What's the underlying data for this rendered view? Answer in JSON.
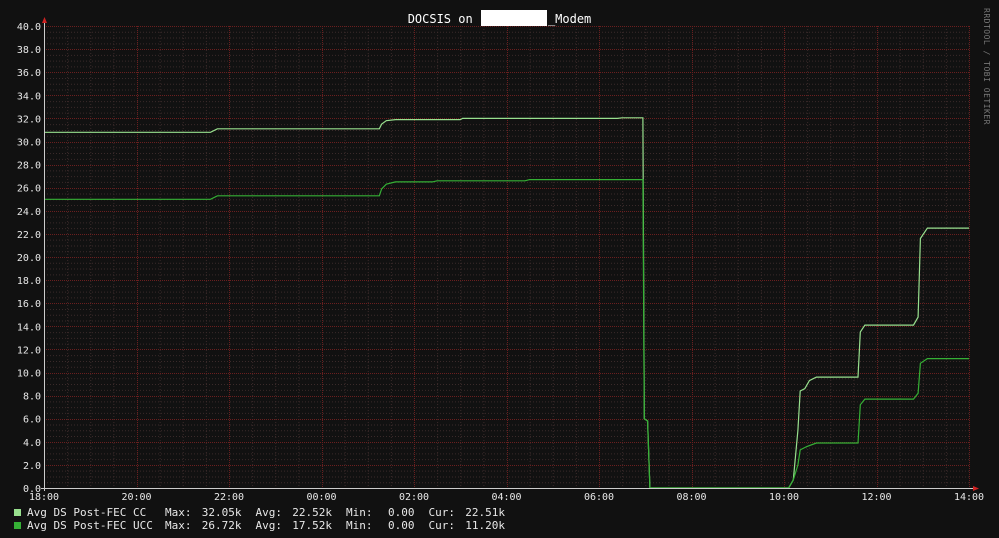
{
  "chart_data": {
    "type": "line",
    "title": "DOCSIS on [redacted]_Modem",
    "title_prefix": "DOCSIS on ",
    "title_suffix": "_Modem",
    "vertical_label": "RRDTOOL / TOBI OETIKER",
    "xlabel": "",
    "ylabel": "",
    "ylim": [
      0,
      40
    ],
    "yticks": [
      "0.0",
      "2.0",
      "4.0",
      "6.0",
      "8.0",
      "10.0",
      "12.0",
      "14.0",
      "16.0",
      "18.0",
      "20.0",
      "22.0",
      "24.0",
      "26.0",
      "28.0",
      "30.0",
      "32.0",
      "34.0",
      "36.0",
      "38.0",
      "40.0"
    ],
    "xlim": [
      0,
      20
    ],
    "xticks": [
      "18:00",
      "20:00",
      "22:00",
      "00:00",
      "02:00",
      "04:00",
      "06:00",
      "08:00",
      "10:00",
      "12:00",
      "14:00"
    ],
    "grid": true,
    "colors": {
      "background": "#111111",
      "grid_major": "#6a1f1f",
      "grid_minor": "#3a2a2a",
      "axis": "#cccccc",
      "cc": "#98e08e",
      "ucc": "#35b035"
    },
    "series": [
      {
        "name": "Avg DS Post-FEC CC",
        "color": "#98e08e",
        "points": [
          [
            0,
            30.8
          ],
          [
            3.6,
            30.8
          ],
          [
            3.75,
            31.1
          ],
          [
            7.25,
            31.1
          ],
          [
            7.3,
            31.5
          ],
          [
            7.4,
            31.8
          ],
          [
            7.6,
            31.9
          ],
          [
            9.0,
            31.9
          ],
          [
            9.05,
            32.0
          ],
          [
            12.4,
            32.0
          ],
          [
            12.5,
            32.05
          ],
          [
            12.95,
            32.05
          ],
          [
            12.98,
            6.0
          ],
          [
            13.05,
            5.8
          ],
          [
            13.1,
            0
          ],
          [
            16.1,
            0
          ],
          [
            16.2,
            0.7
          ],
          [
            16.3,
            5.0
          ],
          [
            16.35,
            8.4
          ],
          [
            16.45,
            8.6
          ],
          [
            16.55,
            9.3
          ],
          [
            16.7,
            9.6
          ],
          [
            17.6,
            9.6
          ],
          [
            17.65,
            13.5
          ],
          [
            17.75,
            14.1
          ],
          [
            18.8,
            14.1
          ],
          [
            18.9,
            14.8
          ],
          [
            18.95,
            21.6
          ],
          [
            19.1,
            22.5
          ],
          [
            20,
            22.5
          ]
        ]
      },
      {
        "name": "Avg DS Post-FEC UCC",
        "color": "#35b035",
        "points": [
          [
            0,
            25.0
          ],
          [
            3.6,
            25.0
          ],
          [
            3.75,
            25.3
          ],
          [
            7.25,
            25.3
          ],
          [
            7.3,
            25.9
          ],
          [
            7.4,
            26.3
          ],
          [
            7.6,
            26.5
          ],
          [
            8.4,
            26.5
          ],
          [
            8.5,
            26.6
          ],
          [
            10.4,
            26.6
          ],
          [
            10.5,
            26.7
          ],
          [
            12.95,
            26.7
          ],
          [
            12.98,
            6.0
          ],
          [
            13.05,
            5.8
          ],
          [
            13.1,
            0
          ],
          [
            16.1,
            0
          ],
          [
            16.2,
            0.7
          ],
          [
            16.3,
            2.0
          ],
          [
            16.35,
            3.3
          ],
          [
            16.5,
            3.6
          ],
          [
            16.7,
            3.9
          ],
          [
            17.6,
            3.9
          ],
          [
            17.65,
            7.2
          ],
          [
            17.75,
            7.7
          ],
          [
            18.8,
            7.7
          ],
          [
            18.9,
            8.2
          ],
          [
            18.95,
            10.8
          ],
          [
            19.1,
            11.2
          ],
          [
            20,
            11.2
          ]
        ]
      }
    ],
    "legend": [
      {
        "name": "Avg DS Post-FEC CC",
        "color": "#98e08e",
        "max_label": "Max:",
        "max": "32.05k",
        "avg_label": "Avg:",
        "avg": "22.52k",
        "min_label": "Min:",
        "min": "0.00",
        "cur_label": "Cur:",
        "cur": "22.51k"
      },
      {
        "name": "Avg DS Post-FEC UCC",
        "color": "#35b035",
        "max_label": "Max:",
        "max": "26.72k",
        "avg_label": "Avg:",
        "avg": "17.52k",
        "min_label": "Min:",
        "min": "0.00",
        "cur_label": "Cur:",
        "cur": "11.20k"
      }
    ]
  }
}
